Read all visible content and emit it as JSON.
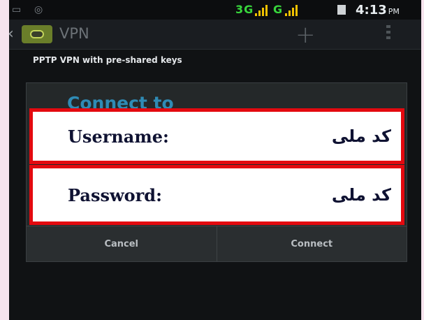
{
  "status_bar": {
    "network": "3G",
    "time": "4:13",
    "ampm": "PM"
  },
  "action_bar": {
    "title": "VPN",
    "add_icon": "plus-icon",
    "menu_icon": "overflow-menu-icon"
  },
  "vpn_item": {
    "description": "PPTP VPN with pre-shared keys"
  },
  "dialog": {
    "title": "Connect to",
    "cancel_label": "Cancel",
    "connect_label": "Connect"
  },
  "credentials": {
    "username_label": "Username:",
    "username_value": "کد ملی",
    "password_label": "Password:",
    "password_value": "کد ملی"
  },
  "colors": {
    "highlight_border": "#e3090f",
    "dialog_title": "#2f8bb5",
    "network_green": "#38d63c"
  }
}
